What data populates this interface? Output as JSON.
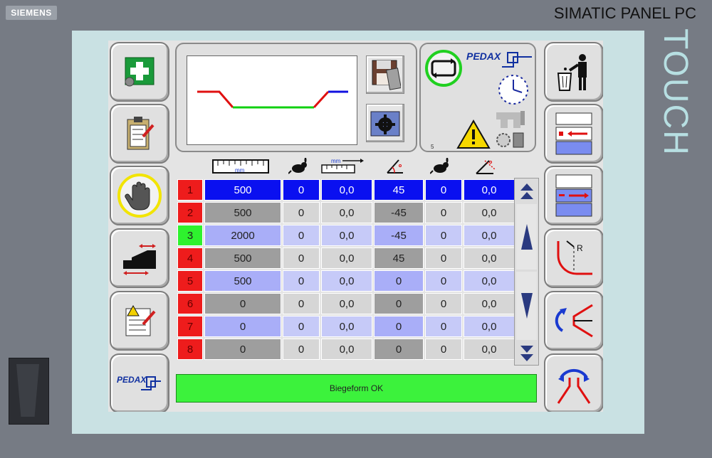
{
  "device": {
    "brand": "SIEMENS",
    "model": "SIMATIC PANEL PC",
    "side_label": "TOUCH"
  },
  "left_buttons": [
    {
      "id": "new",
      "icon": "first-aid-tools-icon"
    },
    {
      "id": "clipboard",
      "icon": "clipboard-edit-icon"
    },
    {
      "id": "stop",
      "icon": "stop-hand-icon"
    },
    {
      "id": "machine",
      "icon": "machine-shift-icon"
    },
    {
      "id": "warning_list",
      "icon": "warning-checklist-icon"
    },
    {
      "id": "pedax",
      "icon": "pedax-logo-icon",
      "label": "PEDAX"
    }
  ],
  "right_buttons": [
    {
      "id": "delete",
      "icon": "trash-person-icon"
    },
    {
      "id": "insert",
      "icon": "insert-row-icon"
    },
    {
      "id": "remove",
      "icon": "remove-row-icon"
    },
    {
      "id": "radius",
      "icon": "radius-bend-icon",
      "label": "R"
    },
    {
      "id": "bend_down",
      "icon": "bend-down-icon"
    },
    {
      "id": "bend_up",
      "icon": "bend-up-icon"
    }
  ],
  "info_panel": {
    "logo": "PEDAX",
    "small_number": "5"
  },
  "column_header_icons": [
    "ruler-mm-icon",
    "rabbit-speed-icon",
    "ruler-mm-offset-icon",
    "angle-icon",
    "rabbit-speed-icon",
    "angle-correction-icon"
  ],
  "header_mm_labels": [
    "mm",
    "mm"
  ],
  "rows": [
    {
      "num": "1",
      "length": "500",
      "speed": "0",
      "offset": "0,0",
      "angle": "45",
      "speed2": "0",
      "corr": "0,0"
    },
    {
      "num": "2",
      "length": "500",
      "speed": "0",
      "offset": "0,0",
      "angle": "-45",
      "speed2": "0",
      "corr": "0,0"
    },
    {
      "num": "3",
      "length": "2000",
      "speed": "0",
      "offset": "0,0",
      "angle": "-45",
      "speed2": "0",
      "corr": "0,0"
    },
    {
      "num": "4",
      "length": "500",
      "speed": "0",
      "offset": "0,0",
      "angle": "45",
      "speed2": "0",
      "corr": "0,0"
    },
    {
      "num": "5",
      "length": "500",
      "speed": "0",
      "offset": "0,0",
      "angle": "0",
      "speed2": "0",
      "corr": "0,0"
    },
    {
      "num": "6",
      "length": "0",
      "speed": "0",
      "offset": "0,0",
      "angle": "0",
      "speed2": "0",
      "corr": "0,0"
    },
    {
      "num": "7",
      "length": "0",
      "speed": "0",
      "offset": "0,0",
      "angle": "0",
      "speed2": "0",
      "corr": "0,0"
    },
    {
      "num": "8",
      "length": "0",
      "speed": "0",
      "offset": "0,0",
      "angle": "0",
      "speed2": "0",
      "corr": "0,0"
    }
  ],
  "status_text": "Biegeform OK",
  "colors": {
    "selected_row": "#0a10f0",
    "row_num_red": "#ee1c1c",
    "row_num_green": "#2ef22e",
    "status_green": "#3cf23c"
  }
}
